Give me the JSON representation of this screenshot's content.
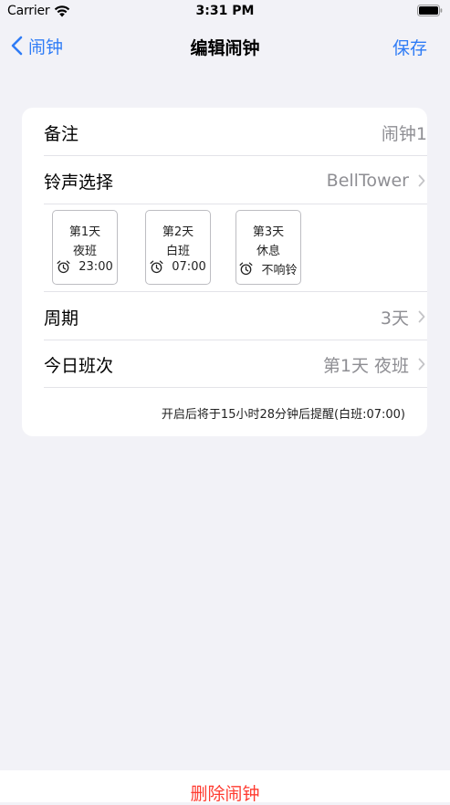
{
  "status_bar": {
    "carrier": "Carrier",
    "time": "3:31 PM"
  },
  "nav": {
    "back_label": "闹钟",
    "title": "编辑闹钟",
    "save_label": "保存"
  },
  "form": {
    "note": {
      "label": "备注",
      "value": "闹钟1"
    },
    "ringtone": {
      "label": "铃声选择",
      "value": "BellTower"
    },
    "shifts": [
      {
        "day": "第1天",
        "shift": "夜班",
        "alarm": "23:00"
      },
      {
        "day": "第2天",
        "shift": "白班",
        "alarm": "07:00"
      },
      {
        "day": "第3天",
        "shift": "休息",
        "alarm": "不响铃"
      }
    ],
    "cycle": {
      "label": "周期",
      "value": "3天"
    },
    "today_shift": {
      "label": "今日班次",
      "value": "第1天 夜班"
    },
    "reminder": "开启后将于15小时28分钟后提醒(白班:07:00)"
  },
  "footer": {
    "delete_label": "删除闹钟"
  },
  "colors": {
    "accent": "#2F7CF6",
    "destructive": "#FF3B30",
    "secondary_text": "#8E8E93",
    "background": "#F2F2F7"
  },
  "icons": {
    "wifi": "wifi-icon",
    "battery": "battery-icon",
    "back": "chevron-left-icon",
    "disclosure": "chevron-right-icon",
    "alarm": "alarm-clock-icon"
  }
}
